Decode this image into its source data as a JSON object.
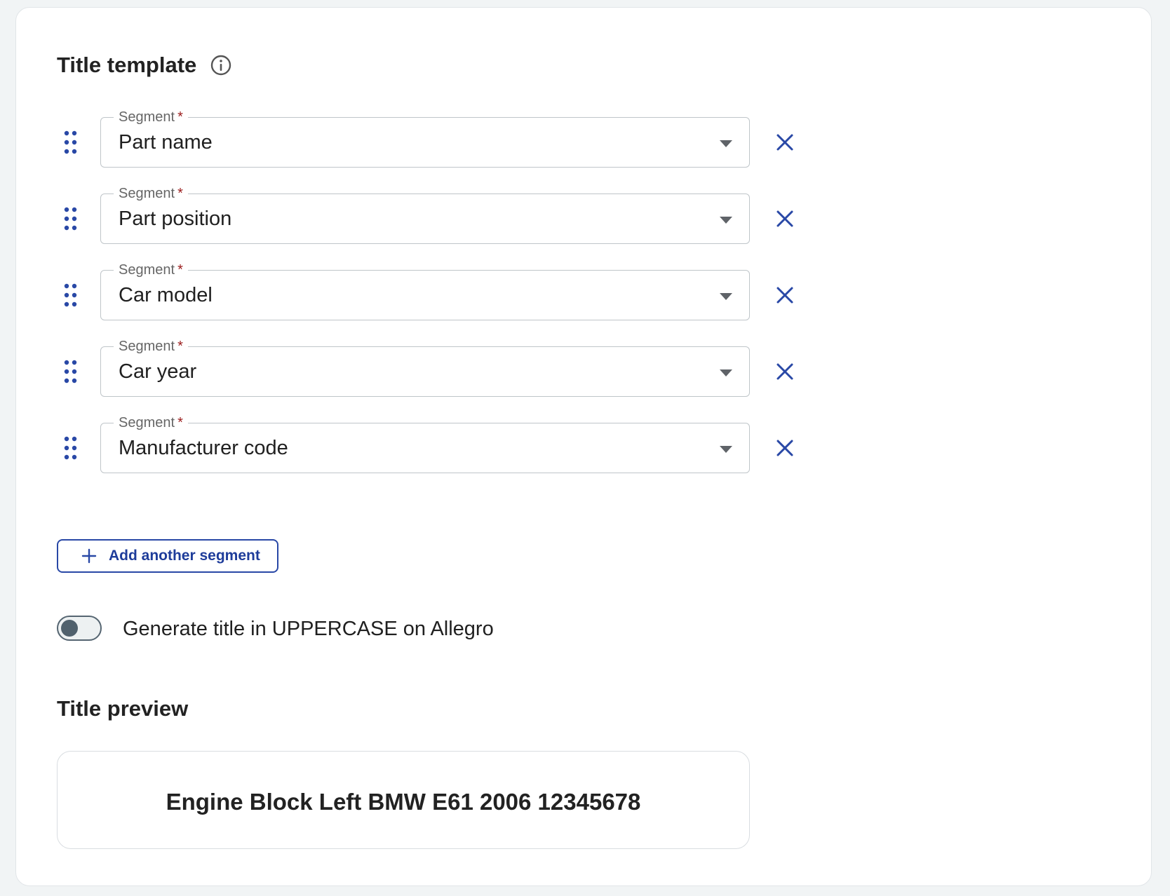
{
  "title_template": {
    "heading": "Title template",
    "info_icon": "info-circle-icon"
  },
  "segments": [
    {
      "label": "Segment",
      "required_marker": "*",
      "value": "Part name"
    },
    {
      "label": "Segment",
      "required_marker": "*",
      "value": "Part position"
    },
    {
      "label": "Segment",
      "required_marker": "*",
      "value": "Car model"
    },
    {
      "label": "Segment",
      "required_marker": "*",
      "value": "Car year"
    },
    {
      "label": "Segment",
      "required_marker": "*",
      "value": "Manufacturer code"
    }
  ],
  "segment_icons": {
    "drag": "drag-handle-icon",
    "remove": "close-icon",
    "dropdown": "chevron-down-icon"
  },
  "add_button": {
    "label": "Add another segment",
    "icon": "plus-icon"
  },
  "uppercase_toggle": {
    "label": "Generate title in UPPERCASE on Allegro",
    "enabled": false
  },
  "title_preview": {
    "heading": "Title preview",
    "text": "Engine Block Left BMW E61 2006 12345678"
  },
  "colors": {
    "accent": "#2948a6",
    "required": "#9b1c1c",
    "toggle_off": "#50616d",
    "page_background": "#f1f4f5"
  }
}
